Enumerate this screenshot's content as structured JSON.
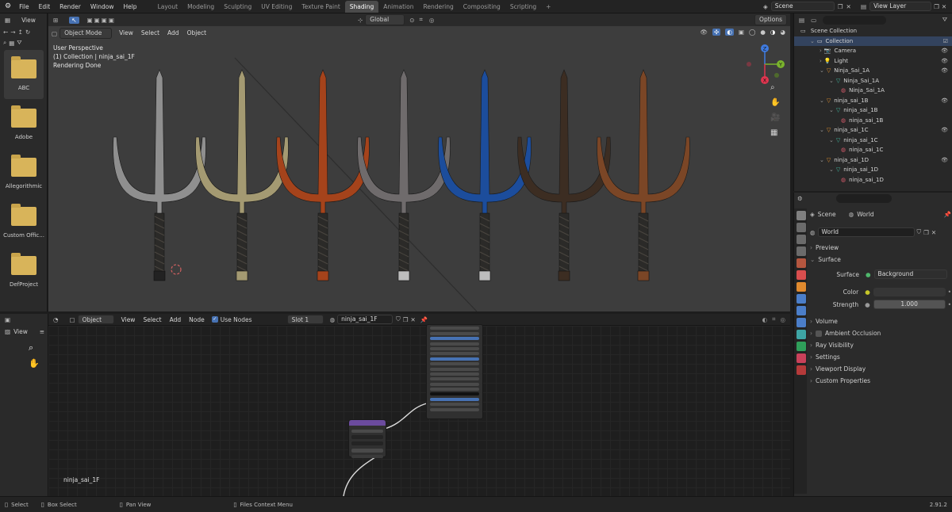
{
  "topbar": {
    "menu": [
      "File",
      "Edit",
      "Render",
      "Window",
      "Help"
    ],
    "workspaces": [
      "Layout",
      "Modeling",
      "Sculpting",
      "UV Editing",
      "Texture Paint",
      "Shading",
      "Animation",
      "Rendering",
      "Compositing",
      "Scripting"
    ],
    "active_workspace": "Shading",
    "add_tab": "+",
    "scene_value": "Scene",
    "view_layer_value": "View Layer"
  },
  "left_panel": {
    "view_label": "View",
    "folders": [
      "ABC",
      "Adobe",
      "Allegorithmic",
      "Custom Offic...",
      "DefProject"
    ]
  },
  "viewport": {
    "mode": "Object Mode",
    "menus": [
      "View",
      "Select",
      "Add",
      "Object"
    ],
    "orientation": "Global",
    "options": "Options",
    "overlay_line1": "User Perspective",
    "overlay_line2": "(1) Collection | ninja_sai_1F",
    "overlay_line3": "Rendering Done",
    "gizmo": {
      "x": "X",
      "y": "Y",
      "z": "Z"
    },
    "sai_colors": [
      "#8f8f8f",
      "#a49a72",
      "#a5431b",
      "#6f6b6c",
      "#1c4d9c",
      "#3c2d22",
      "#7b4626"
    ]
  },
  "outliner": {
    "root": "Scene Collection",
    "rows": [
      {
        "label": "Collection",
        "indent": 1,
        "icon": "collection"
      },
      {
        "label": "Camera",
        "indent": 2,
        "icon": "camera"
      },
      {
        "label": "Light",
        "indent": 2,
        "icon": "light"
      },
      {
        "label": "Ninja_Sai_1A",
        "indent": 2,
        "icon": "object"
      },
      {
        "label": "Ninja_Sai_1A",
        "indent": 3,
        "icon": "mesh"
      },
      {
        "label": "Ninja_Sai_1A",
        "indent": 4,
        "icon": "material"
      },
      {
        "label": "ninja_sai_1B",
        "indent": 2,
        "icon": "object"
      },
      {
        "label": "ninja_sai_1B",
        "indent": 3,
        "icon": "mesh"
      },
      {
        "label": "ninja_sai_1B",
        "indent": 4,
        "icon": "material"
      },
      {
        "label": "ninja_sai_1C",
        "indent": 2,
        "icon": "object"
      },
      {
        "label": "ninja_sai_1C",
        "indent": 3,
        "icon": "mesh"
      },
      {
        "label": "ninja_sai_1C",
        "indent": 4,
        "icon": "material"
      },
      {
        "label": "ninja_sai_1D",
        "indent": 2,
        "icon": "object"
      },
      {
        "label": "ninja_sai_1D",
        "indent": 3,
        "icon": "mesh"
      },
      {
        "label": "ninja_sai_1D",
        "indent": 4,
        "icon": "material"
      }
    ]
  },
  "properties": {
    "breadcrumb_scene": "Scene",
    "breadcrumb_world": "World",
    "world_name": "World",
    "preview": "Preview",
    "surface": "Surface",
    "surface_label": "Surface",
    "surface_value": "Background",
    "color_label": "Color",
    "strength_label": "Strength",
    "strength_value": "1.000",
    "sections": [
      "Volume",
      "Ambient Occlusion",
      "Ray Visibility",
      "Settings",
      "Viewport Display",
      "Custom Properties"
    ]
  },
  "node_editor": {
    "editor_type": "Object",
    "menus": [
      "View",
      "Select",
      "Add",
      "Node"
    ],
    "use_nodes": "Use Nodes",
    "slot": "Slot 1",
    "material": "ninja_sai_1F",
    "left_view": "View",
    "object_label": "ninja_sai_1F"
  },
  "statusbar": {
    "select": "Select",
    "box_select": "Box Select",
    "pan_view": "Pan View",
    "context_menu": "Files Context Menu",
    "version": "2.91.2"
  }
}
